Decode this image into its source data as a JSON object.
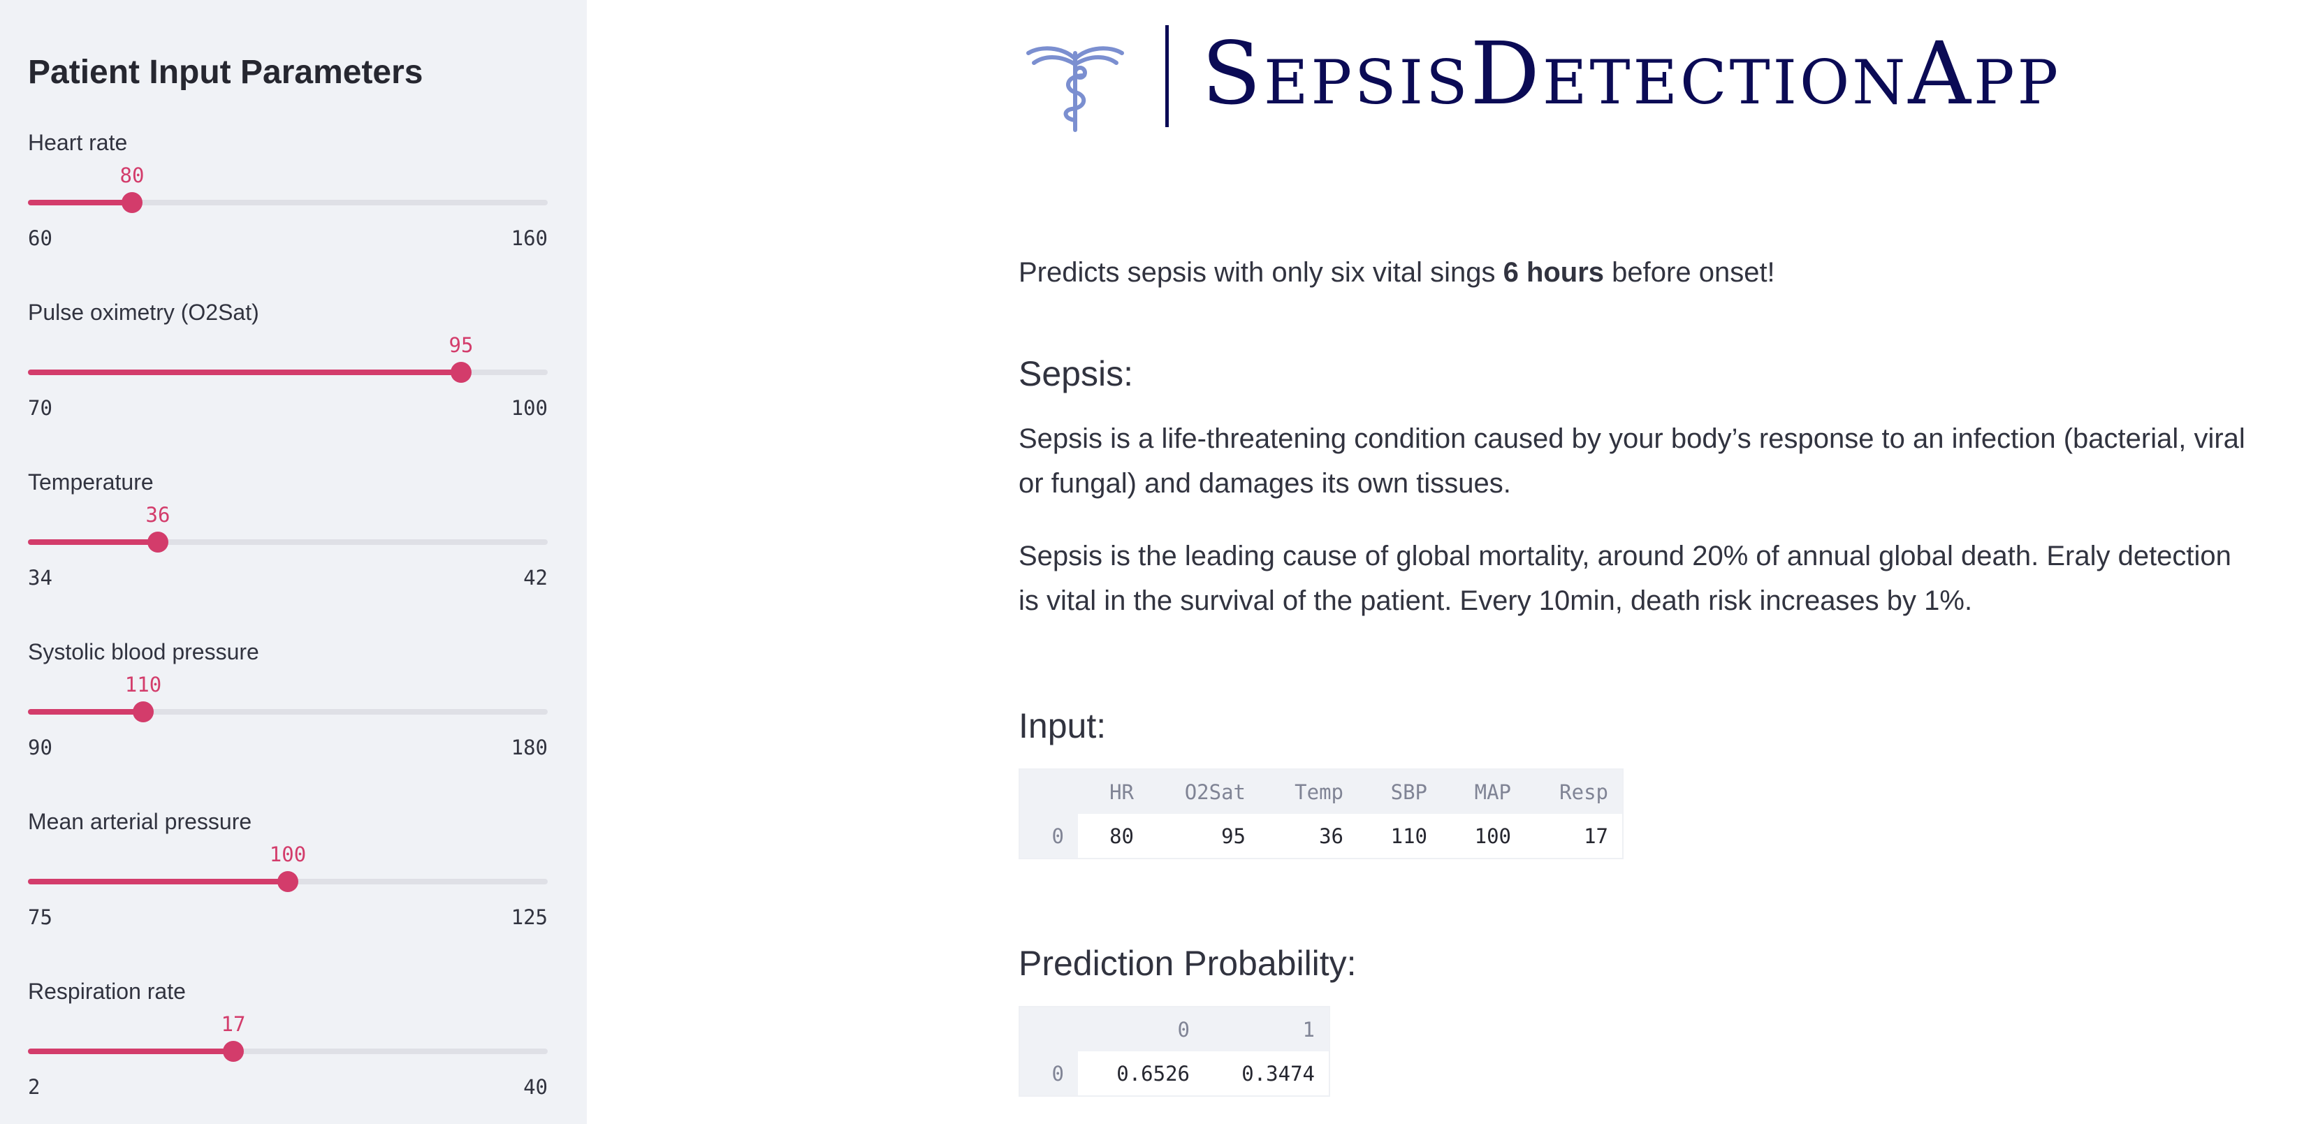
{
  "sidebar": {
    "title": "Patient Input Parameters",
    "sliders": [
      {
        "label": "Heart rate",
        "value": 80,
        "value_text": "80",
        "min": "60",
        "max": "160",
        "min_v": 60,
        "max_v": 160
      },
      {
        "label": "Pulse oximetry (O2Sat)",
        "value": 95,
        "value_text": "95",
        "min": "70",
        "max": "100",
        "min_v": 70,
        "max_v": 100
      },
      {
        "label": "Temperature",
        "value": 36,
        "value_text": "36",
        "min": "34",
        "max": "42",
        "min_v": 34,
        "max_v": 42
      },
      {
        "label": "Systolic blood pressure",
        "value": 110,
        "value_text": "110",
        "min": "90",
        "max": "180",
        "min_v": 90,
        "max_v": 180
      },
      {
        "label": "Mean arterial pressure",
        "value": 100,
        "value_text": "100",
        "min": "75",
        "max": "125",
        "min_v": 75,
        "max_v": 125
      },
      {
        "label": "Respiration rate",
        "value": 17,
        "value_text": "17",
        "min": "2",
        "max": "40",
        "min_v": 2,
        "max_v": 40
      }
    ]
  },
  "main": {
    "logo_text": "SepsisDetectionApp",
    "tagline": {
      "before": "Predicts sepsis with only six vital sings ",
      "bold": "6 hours",
      "after": " before onset!"
    },
    "sepsis_heading": "Sepsis:",
    "sepsis_p1": "Sepsis is a life-threatening condition caused by your body’s response to an infection (bacterial, viral or fungal) and damages its own tissues.",
    "sepsis_p2": "Sepsis is the leading cause of global mortality, around 20% of annual global death. Eraly detection is vital in the survival of the patient. Every 10min, death risk increases by 1%.",
    "input_heading": "Input:",
    "input_table": {
      "columns": [
        "HR",
        "O2Sat",
        "Temp",
        "SBP",
        "MAP",
        "Resp"
      ],
      "rows": [
        {
          "index": "0",
          "cells": [
            "80",
            "95",
            "36",
            "110",
            "100",
            "17"
          ]
        }
      ]
    },
    "prediction_heading": "Prediction Probability:",
    "prediction_table": {
      "columns": [
        "0",
        "1"
      ],
      "rows": [
        {
          "index": "0",
          "cells": [
            "0.6526",
            "0.3474"
          ]
        }
      ]
    }
  },
  "colors": {
    "accent": "#d33c6b",
    "sidebar_bg": "#f0f2f6",
    "logo": "#0b0b55",
    "logo_icon": "#7b8fd0"
  }
}
